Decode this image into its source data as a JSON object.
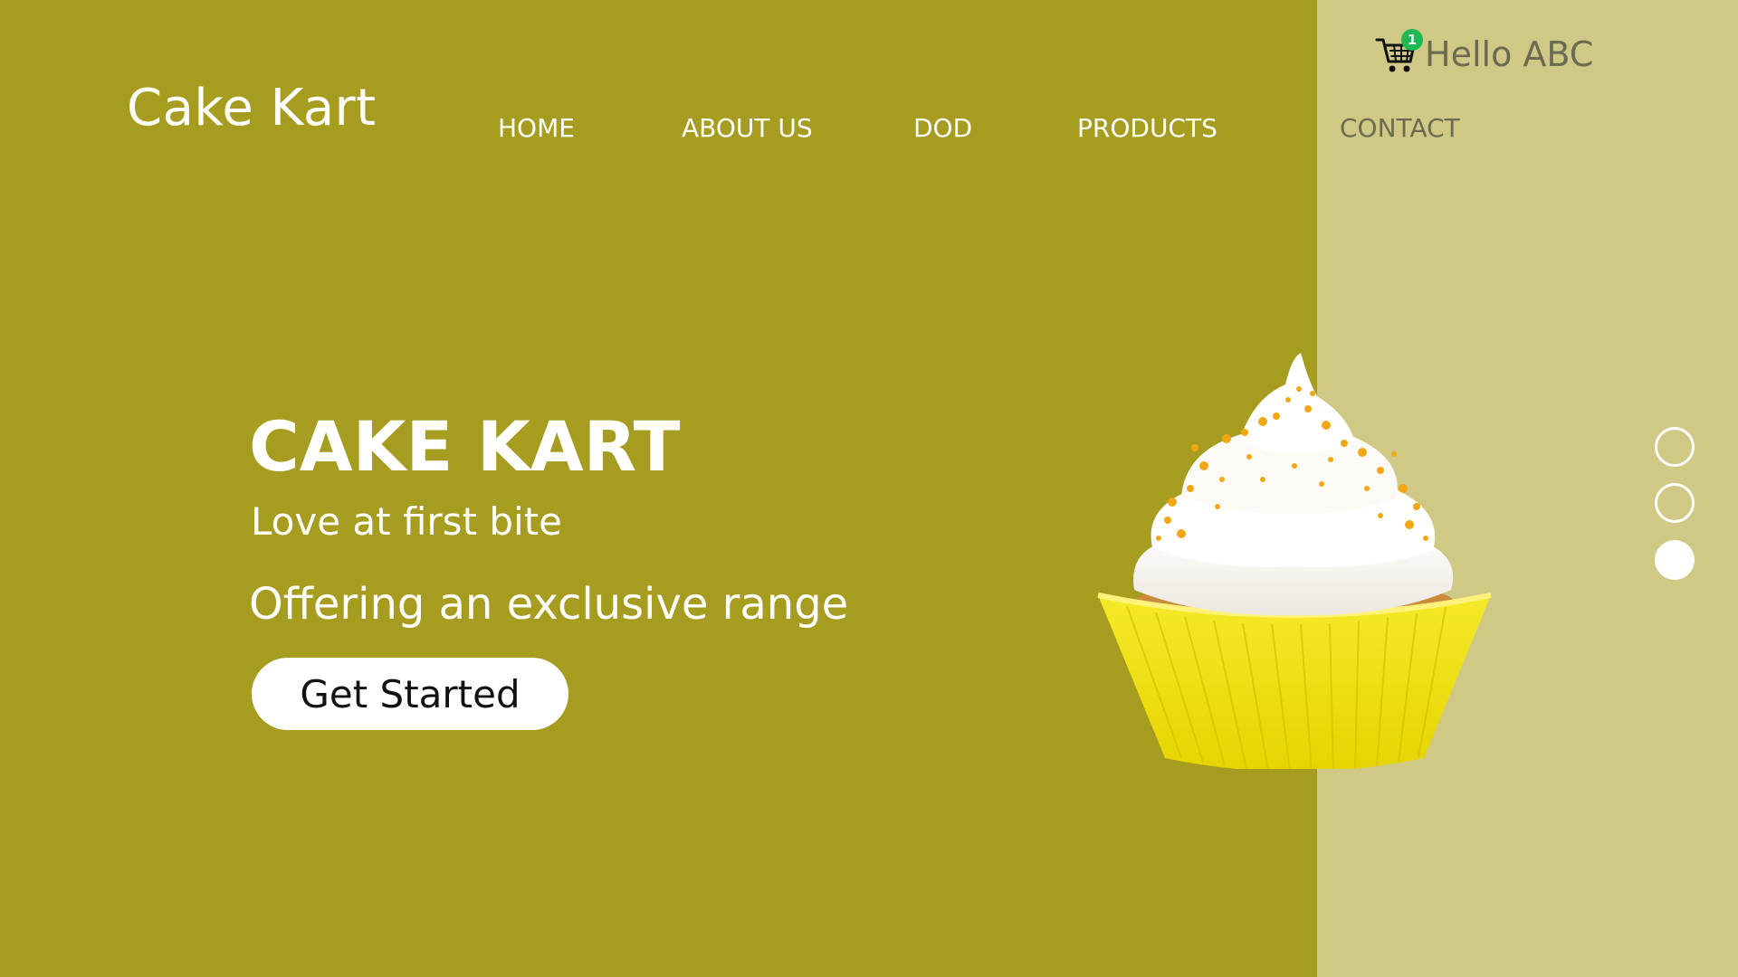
{
  "brand": {
    "logo": "Cake Kart"
  },
  "nav": {
    "items": [
      {
        "label": "HOME"
      },
      {
        "label": "ABOUT US"
      },
      {
        "label": "DOD"
      },
      {
        "label": "PRODUCTS"
      },
      {
        "label": "CONTACT"
      }
    ]
  },
  "header": {
    "cart_count": "1",
    "greeting": "Hello ABC"
  },
  "hero": {
    "title": "CAKE KART",
    "tagline": "Love at first bite",
    "description": "Offering an exclusive range",
    "cta_label": "Get Started"
  },
  "slider": {
    "slide_count": 3,
    "active_index": 2
  },
  "colors": {
    "primary_bg": "#a69d20",
    "secondary_bg": "#cfc985",
    "badge": "#1db955",
    "accent_text": "#ffffff"
  },
  "icons": [
    "shopping-cart-icon",
    "cupcake-image"
  ]
}
